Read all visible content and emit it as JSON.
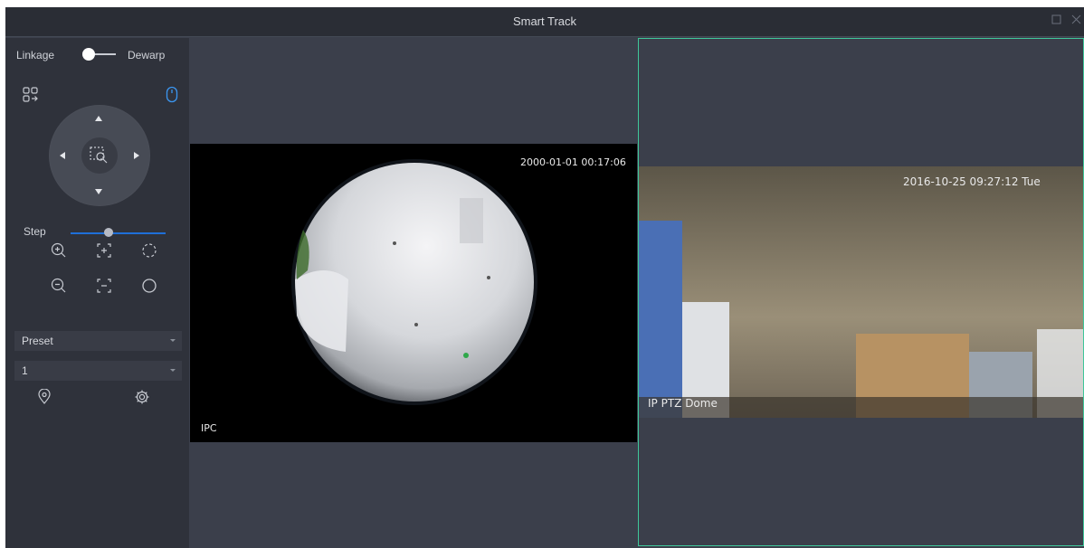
{
  "window": {
    "title": "Smart Track"
  },
  "controls": {
    "linkage_label": "Linkage",
    "dewarp_label": "Dewarp",
    "step_label": "Step",
    "step_level": 0.4,
    "preset_label": "Preset",
    "preset_number": "1"
  },
  "views": {
    "fisheye": {
      "timestamp": "2000-01-01 00:17:06",
      "label": "IPC"
    },
    "ptz": {
      "timestamp": "2016-10-25 09:27:12 Tue",
      "label": "IP PTZ Dome"
    }
  },
  "colors": {
    "accent": "#1f6fd8",
    "selected_border": "#3fc79a",
    "pane_bg": "#3b3f4b",
    "panel_bg": "#2f323b"
  }
}
